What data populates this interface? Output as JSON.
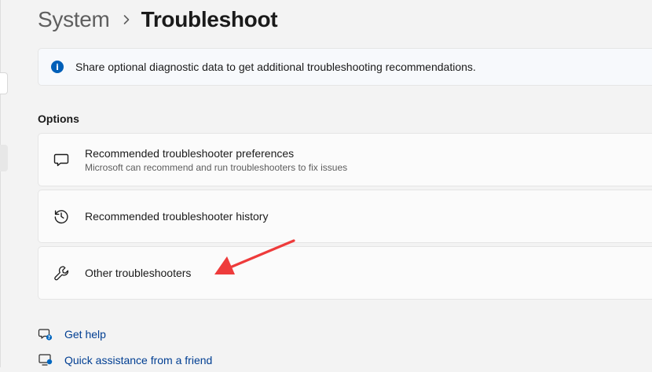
{
  "breadcrumb": {
    "parent": "System",
    "current": "Troubleshoot",
    "separator_icon": "chevron-right-icon"
  },
  "info_bar": {
    "icon": "info-icon",
    "icon_glyph": "i",
    "message": "Share optional diagnostic data to get additional troubleshooting recommendations."
  },
  "options": {
    "heading": "Options",
    "items": [
      {
        "icon": "chat-bubble-icon",
        "title": "Recommended troubleshooter preferences",
        "description": "Microsoft can recommend and run troubleshooters to fix issues"
      },
      {
        "icon": "history-icon",
        "title": "Recommended troubleshooter history"
      },
      {
        "icon": "wrench-icon",
        "title": "Other troubleshooters"
      }
    ]
  },
  "help_links": [
    {
      "icon": "get-help-icon",
      "label": "Get help"
    },
    {
      "icon": "quick-assist-icon",
      "label": "Quick assistance from a friend"
    }
  ],
  "annotation": {
    "icon": "red-arrow-icon",
    "color": "#ee3b3b"
  },
  "colors": {
    "accent": "#005fb8",
    "link": "#003e92",
    "background": "#f3f3f3",
    "card": "#fbfbfb"
  }
}
